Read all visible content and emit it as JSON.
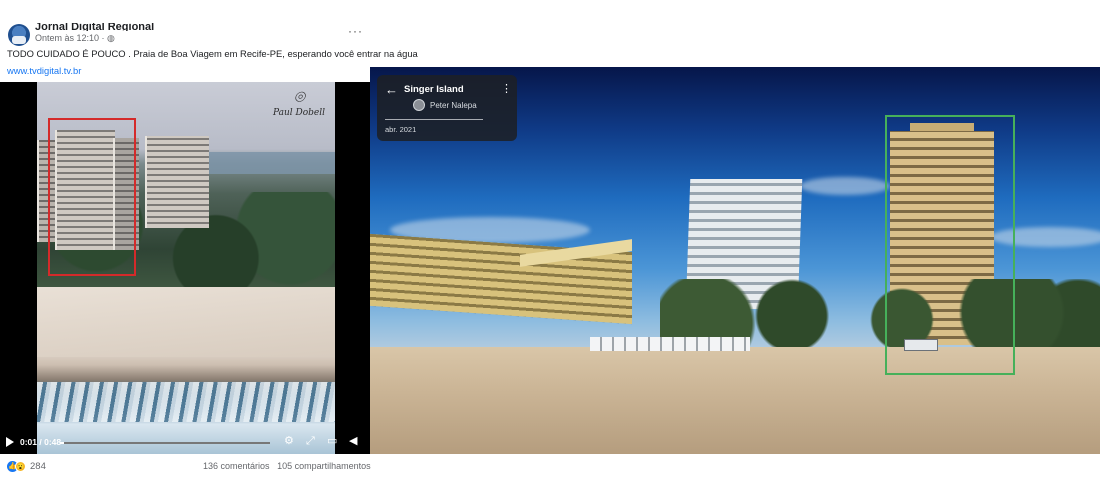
{
  "post": {
    "page_name": "Jornal Digital Regional",
    "timestamp": "Ontem às 12:10 · ",
    "caption": "TODO CUIDADO É POUCO . Praia de Boa Viagem em Recife-PE, esperando você entrar na água",
    "link": "www.tvdigital.tv.br",
    "more_icon": "···",
    "globe_icon": "◍"
  },
  "video": {
    "time": "0:01 / 0:48",
    "progress": 0.02,
    "watermark": "Paul Dobell",
    "controls": [
      "gear-icon",
      "expand-icon",
      "pip-icon",
      "volume-icon"
    ]
  },
  "reactions": {
    "count": "284",
    "comments": "136 comentários",
    "shares": "105 compartilhamentos"
  },
  "streetview": {
    "title": "Singer Island",
    "author": "Peter Nalepa",
    "date": "abr. 2021",
    "back_icon": "←",
    "kebab_icon": "⋮"
  },
  "colors": {
    "red_box": "#d42a2a",
    "green_box": "#46b05a",
    "link": "#1877f2"
  }
}
